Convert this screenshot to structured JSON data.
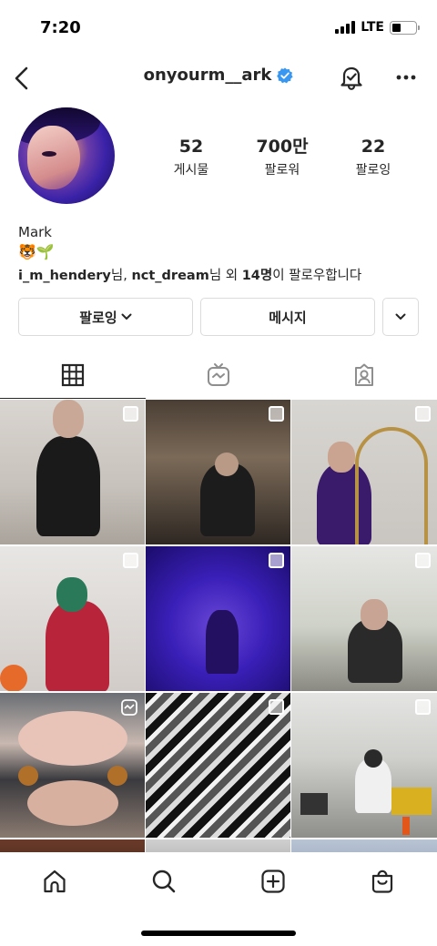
{
  "status": {
    "time": "7:20",
    "network": "LTE",
    "battery_level": 0.38
  },
  "profile": {
    "username": "onyourm__ark",
    "verified": true
  },
  "stats": [
    {
      "value": "52",
      "label": "게시물"
    },
    {
      "value": "700만",
      "label": "팔로워"
    },
    {
      "value": "22",
      "label": "팔로잉"
    }
  ],
  "bio": {
    "name": "Mark",
    "emoji": "🐯🌱",
    "followed_by": {
      "user1": "i_m_hendery",
      "suffix1": "님, ",
      "user2": "nct_dream",
      "suffix2": "님 외 ",
      "count": "14명",
      "suffix3": "이 팔로우합니다"
    }
  },
  "actions": {
    "following": "팔로잉",
    "message": "메시지"
  },
  "tabs": [
    "grid",
    "reels",
    "tagged"
  ],
  "icons": {
    "back": "chevron-left-icon",
    "verified": "verified-badge-icon",
    "bell": "notification-bell-icon",
    "more": "more-icon",
    "grid": "grid-icon",
    "reels": "igtv-icon",
    "tagged": "tagged-icon",
    "home": "home-icon",
    "search": "search-icon",
    "create": "create-icon",
    "shop": "shop-icon"
  },
  "colors": {
    "accent": "#3897f0",
    "text": "#262626",
    "border": "#dbdbdb"
  }
}
